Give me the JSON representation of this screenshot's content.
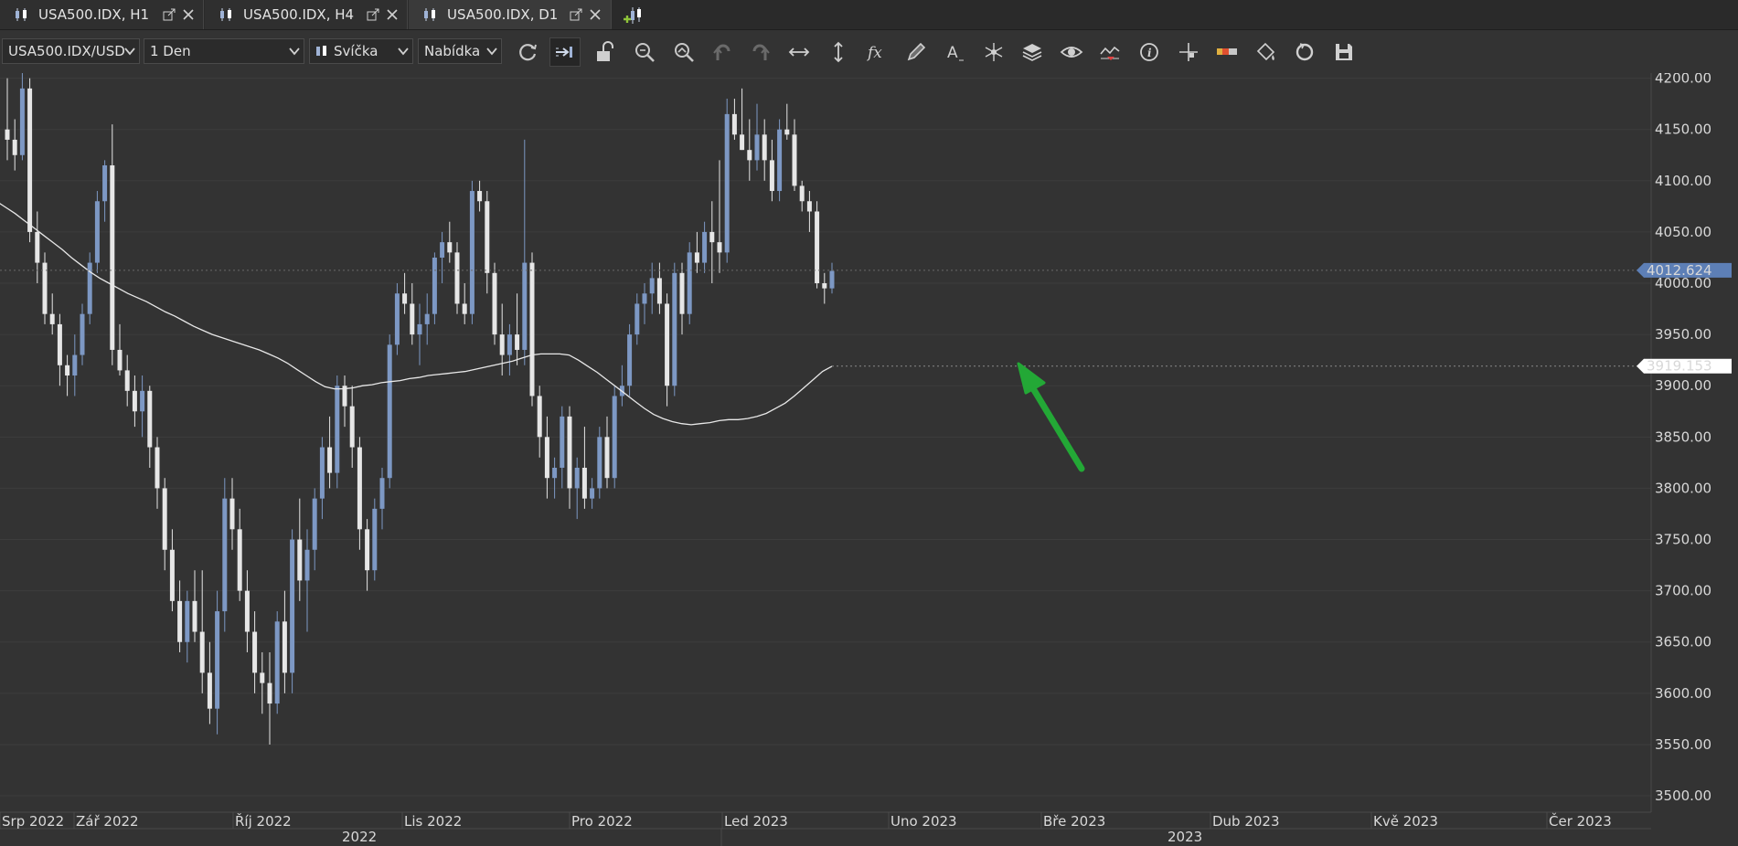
{
  "tabs": [
    {
      "label": "USA500.IDX, H1",
      "active": false
    },
    {
      "label": "USA500.IDX, H4",
      "active": false
    },
    {
      "label": "USA500.IDX, D1",
      "active": true
    }
  ],
  "toolbar": {
    "instrument": "USA500.IDX/USD",
    "period": "1 Den",
    "chart_type": "Svíčka",
    "price_side": "Nabídka",
    "tools": [
      "refresh-icon",
      "shift-chart-icon",
      "lock-icon",
      "zoom-in-icon",
      "zoom-out-icon",
      "undo-icon",
      "redo-icon",
      "horizontal-scale-icon",
      "vertical-scale-icon",
      "indicators-fx-icon",
      "pencil-icon",
      "text-icon",
      "objects-icon",
      "layers-icon",
      "eye-icon",
      "signals-icon",
      "info-icon",
      "crosshair-icon",
      "ruler-icon",
      "paint-icon",
      "sync-icon",
      "save-icon"
    ]
  },
  "chart_data": {
    "type": "candlestick",
    "y_axis": {
      "ticks": [
        "4200.00",
        "4150.00",
        "4100.00",
        "4050.00",
        "4000.00",
        "3950.00",
        "3900.00",
        "3850.00",
        "3800.00",
        "3750.00",
        "3700.00",
        "3650.00",
        "3600.00",
        "3550.00",
        "3500.00"
      ],
      "range": [
        3484,
        4205
      ],
      "position": "right"
    },
    "x_axis": {
      "months": [
        "Srp 2022",
        "Zář 2022",
        "Říj 2022",
        "Lis 2022",
        "Pro 2022",
        "Led 2023",
        "Uno 2023",
        "Bře 2023",
        "Dub 2023",
        "Kvě 2023",
        "Čer 2023"
      ],
      "years": [
        "2022",
        "2023"
      ]
    },
    "price_labels": {
      "last_price": "4012.624",
      "moving_average": "3919.153"
    },
    "colors": {
      "up": "#7d98c4",
      "down": "#e6e6e6",
      "background": "#333333",
      "ma_line": "#e8e8e8",
      "arrow": "#2eb03a",
      "grid": "#3d3d3d"
    },
    "candles": [
      [
        4150,
        4200,
        4120,
        4140
      ],
      [
        4140,
        4160,
        4110,
        4125
      ],
      [
        4125,
        4210,
        4120,
        4190
      ],
      [
        4190,
        4200,
        4040,
        4050
      ],
      [
        4050,
        4070,
        4000,
        4020
      ],
      [
        4020,
        4030,
        3960,
        3970
      ],
      [
        3970,
        3990,
        3950,
        3960
      ],
      [
        3960,
        3970,
        3900,
        3920
      ],
      [
        3920,
        3930,
        3890,
        3910
      ],
      [
        3910,
        3950,
        3890,
        3930
      ],
      [
        3930,
        3980,
        3920,
        3970
      ],
      [
        3970,
        4030,
        3960,
        4020
      ],
      [
        4020,
        4090,
        4010,
        4080
      ],
      [
        4080,
        4120,
        4060,
        4115
      ],
      [
        4115,
        4155,
        3920,
        3935
      ],
      [
        3935,
        3960,
        3910,
        3915
      ],
      [
        3915,
        3930,
        3880,
        3895
      ],
      [
        3895,
        3910,
        3860,
        3875
      ],
      [
        3875,
        3910,
        3850,
        3895
      ],
      [
        3895,
        3900,
        3820,
        3840
      ],
      [
        3840,
        3850,
        3780,
        3800
      ],
      [
        3800,
        3810,
        3720,
        3740
      ],
      [
        3740,
        3760,
        3680,
        3690
      ],
      [
        3690,
        3710,
        3640,
        3650
      ],
      [
        3650,
        3700,
        3630,
        3690
      ],
      [
        3690,
        3720,
        3650,
        3660
      ],
      [
        3660,
        3720,
        3600,
        3620
      ],
      [
        3620,
        3650,
        3570,
        3585
      ],
      [
        3585,
        3700,
        3560,
        3680
      ],
      [
        3680,
        3810,
        3660,
        3790
      ],
      [
        3790,
        3810,
        3740,
        3760
      ],
      [
        3760,
        3780,
        3690,
        3700
      ],
      [
        3700,
        3720,
        3640,
        3660
      ],
      [
        3660,
        3680,
        3600,
        3620
      ],
      [
        3620,
        3640,
        3580,
        3610
      ],
      [
        3610,
        3640,
        3550,
        3590
      ],
      [
        3590,
        3680,
        3580,
        3670
      ],
      [
        3670,
        3700,
        3600,
        3620
      ],
      [
        3620,
        3760,
        3600,
        3750
      ],
      [
        3750,
        3790,
        3690,
        3710
      ],
      [
        3710,
        3760,
        3660,
        3740
      ],
      [
        3740,
        3800,
        3720,
        3790
      ],
      [
        3790,
        3850,
        3770,
        3840
      ],
      [
        3840,
        3870,
        3800,
        3815
      ],
      [
        3815,
        3910,
        3800,
        3900
      ],
      [
        3900,
        3910,
        3860,
        3880
      ],
      [
        3880,
        3900,
        3820,
        3840
      ],
      [
        3840,
        3850,
        3740,
        3760
      ],
      [
        3760,
        3770,
        3700,
        3720
      ],
      [
        3720,
        3790,
        3710,
        3780
      ],
      [
        3780,
        3820,
        3760,
        3810
      ],
      [
        3810,
        3950,
        3800,
        3940
      ],
      [
        3940,
        4000,
        3930,
        3990
      ],
      [
        3990,
        4010,
        3970,
        3980
      ],
      [
        3980,
        4000,
        3940,
        3950
      ],
      [
        3950,
        3980,
        3920,
        3960
      ],
      [
        3960,
        3990,
        3940,
        3970
      ],
      [
        3970,
        4030,
        3960,
        4025
      ],
      [
        4025,
        4050,
        4000,
        4040
      ],
      [
        4040,
        4060,
        4020,
        4030
      ],
      [
        4030,
        4040,
        3970,
        3980
      ],
      [
        3980,
        4000,
        3960,
        3970
      ],
      [
        3970,
        4100,
        3960,
        4090
      ],
      [
        4090,
        4100,
        4070,
        4080
      ],
      [
        4080,
        4090,
        3990,
        4010
      ],
      [
        4010,
        4020,
        3940,
        3950
      ],
      [
        3950,
        3980,
        3910,
        3930
      ],
      [
        3930,
        3960,
        3910,
        3950
      ],
      [
        3950,
        3990,
        3920,
        3935
      ],
      [
        3935,
        4140,
        3920,
        4020
      ],
      [
        4020,
        4030,
        3880,
        3890
      ],
      [
        3890,
        3900,
        3830,
        3850
      ],
      [
        3850,
        3870,
        3790,
        3810
      ],
      [
        3810,
        3830,
        3790,
        3820
      ],
      [
        3820,
        3880,
        3800,
        3870
      ],
      [
        3870,
        3880,
        3780,
        3800
      ],
      [
        3800,
        3830,
        3770,
        3820
      ],
      [
        3820,
        3860,
        3780,
        3790
      ],
      [
        3790,
        3810,
        3780,
        3800
      ],
      [
        3800,
        3860,
        3790,
        3850
      ],
      [
        3850,
        3870,
        3800,
        3810
      ],
      [
        3810,
        3900,
        3800,
        3890
      ],
      [
        3890,
        3920,
        3880,
        3900
      ],
      [
        3900,
        3960,
        3890,
        3950
      ],
      [
        3950,
        3990,
        3940,
        3980
      ],
      [
        3980,
        4000,
        3960,
        3990
      ],
      [
        3990,
        4020,
        3970,
        4005
      ],
      [
        4005,
        4020,
        3970,
        3980
      ],
      [
        3980,
        3990,
        3880,
        3900
      ],
      [
        3900,
        4020,
        3890,
        4010
      ],
      [
        4010,
        4020,
        3950,
        3970
      ],
      [
        3970,
        4040,
        3960,
        4030
      ],
      [
        4030,
        4050,
        4010,
        4020
      ],
      [
        4020,
        4060,
        4010,
        4050
      ],
      [
        4050,
        4080,
        4000,
        4040
      ],
      [
        4040,
        4120,
        4010,
        4030
      ],
      [
        4030,
        4180,
        4020,
        4165
      ],
      [
        4165,
        4180,
        4140,
        4145
      ],
      [
        4145,
        4190,
        4130,
        4130
      ],
      [
        4130,
        4160,
        4100,
        4120
      ],
      [
        4120,
        4175,
        4110,
        4145
      ],
      [
        4145,
        4160,
        4100,
        4120
      ],
      [
        4120,
        4140,
        4080,
        4090
      ],
      [
        4090,
        4160,
        4080,
        4150
      ],
      [
        4150,
        4175,
        4140,
        4145
      ],
      [
        4145,
        4160,
        4090,
        4095
      ],
      [
        4095,
        4100,
        4070,
        4080
      ],
      [
        4080,
        4090,
        4050,
        4070
      ],
      [
        4070,
        4080,
        3995,
        4000
      ],
      [
        4000,
        4010,
        3980,
        3995
      ],
      [
        3995,
        4020,
        3990,
        4012
      ]
    ],
    "ma": [
      4080,
      4074,
      4068,
      4061,
      4054,
      4047,
      4040,
      4033,
      4025,
      4018,
      4011,
      4005,
      4000,
      3995,
      3990,
      3986,
      3982,
      3977,
      3972,
      3968,
      3963,
      3958,
      3954,
      3950,
      3947,
      3944,
      3941,
      3938,
      3935,
      3931,
      3927,
      3922,
      3916,
      3910,
      3904,
      3899,
      3897,
      3897,
      3898,
      3900,
      3901,
      3903,
      3904,
      3905,
      3907,
      3908,
      3910,
      3911,
      3912,
      3913,
      3914,
      3916,
      3918,
      3920,
      3922,
      3924,
      3927,
      3930,
      3931,
      3931,
      3931,
      3930,
      3925,
      3919,
      3913,
      3906,
      3899,
      3892,
      3885,
      3878,
      3872,
      3868,
      3865,
      3863,
      3862,
      3863,
      3864,
      3866,
      3867,
      3867,
      3868,
      3870,
      3873,
      3878,
      3883,
      3890,
      3898,
      3906,
      3914,
      3919
    ]
  }
}
